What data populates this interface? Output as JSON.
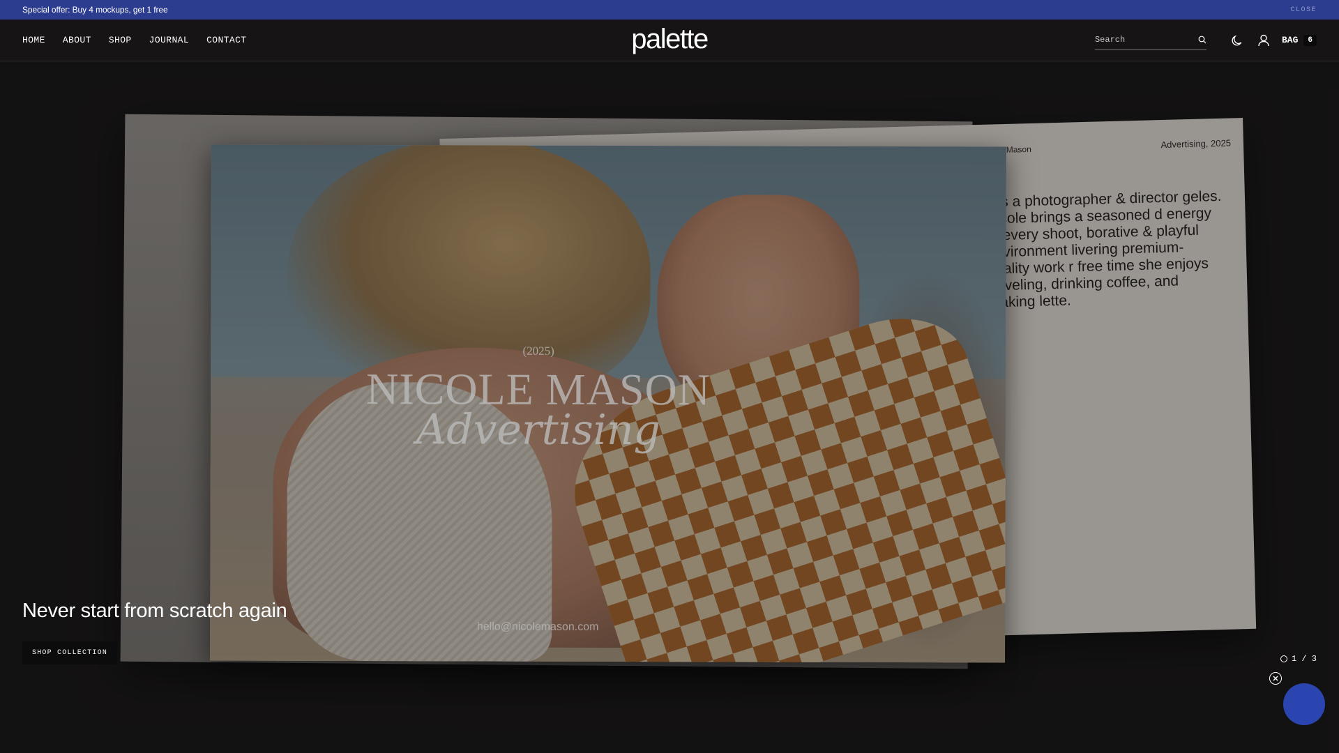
{
  "promo": {
    "text": "Special offer: Buy 4 mockups, get 1 free",
    "close_label": "CLOSE"
  },
  "nav": {
    "items": [
      "HOME",
      "ABOUT",
      "SHOP",
      "JOURNAL",
      "CONTACT"
    ]
  },
  "brand": {
    "logo_text": "palette"
  },
  "search": {
    "placeholder": "Search"
  },
  "bag": {
    "label": "BAG",
    "count": "6"
  },
  "hero": {
    "card_right": {
      "name": "Nicole Mason",
      "meta": "Advertising, 2025",
      "bio": "n is a photographer & director geles. Nicole brings a seasoned d energy to every shoot, borative & playful environment livering premium-quality work r free time she enjoys traveling, drinking coffee, and making lette."
    },
    "photo_card": {
      "year": "(2025)",
      "title": "NICOLE MASON",
      "subtitle": "Advertising",
      "email": "hello@nicolemason.com"
    },
    "headline": "Never start from scratch again",
    "cta_label": "SHOP COLLECTION",
    "pager": "1 / 3"
  },
  "icons": {
    "search": "search-icon",
    "theme": "moon-icon",
    "account": "user-icon",
    "close": "close-icon",
    "chat": "chat-icon"
  },
  "colors": {
    "promo_bg": "#2c3d8f",
    "page_bg": "#161414",
    "chat_blue": "#2a45b0"
  }
}
